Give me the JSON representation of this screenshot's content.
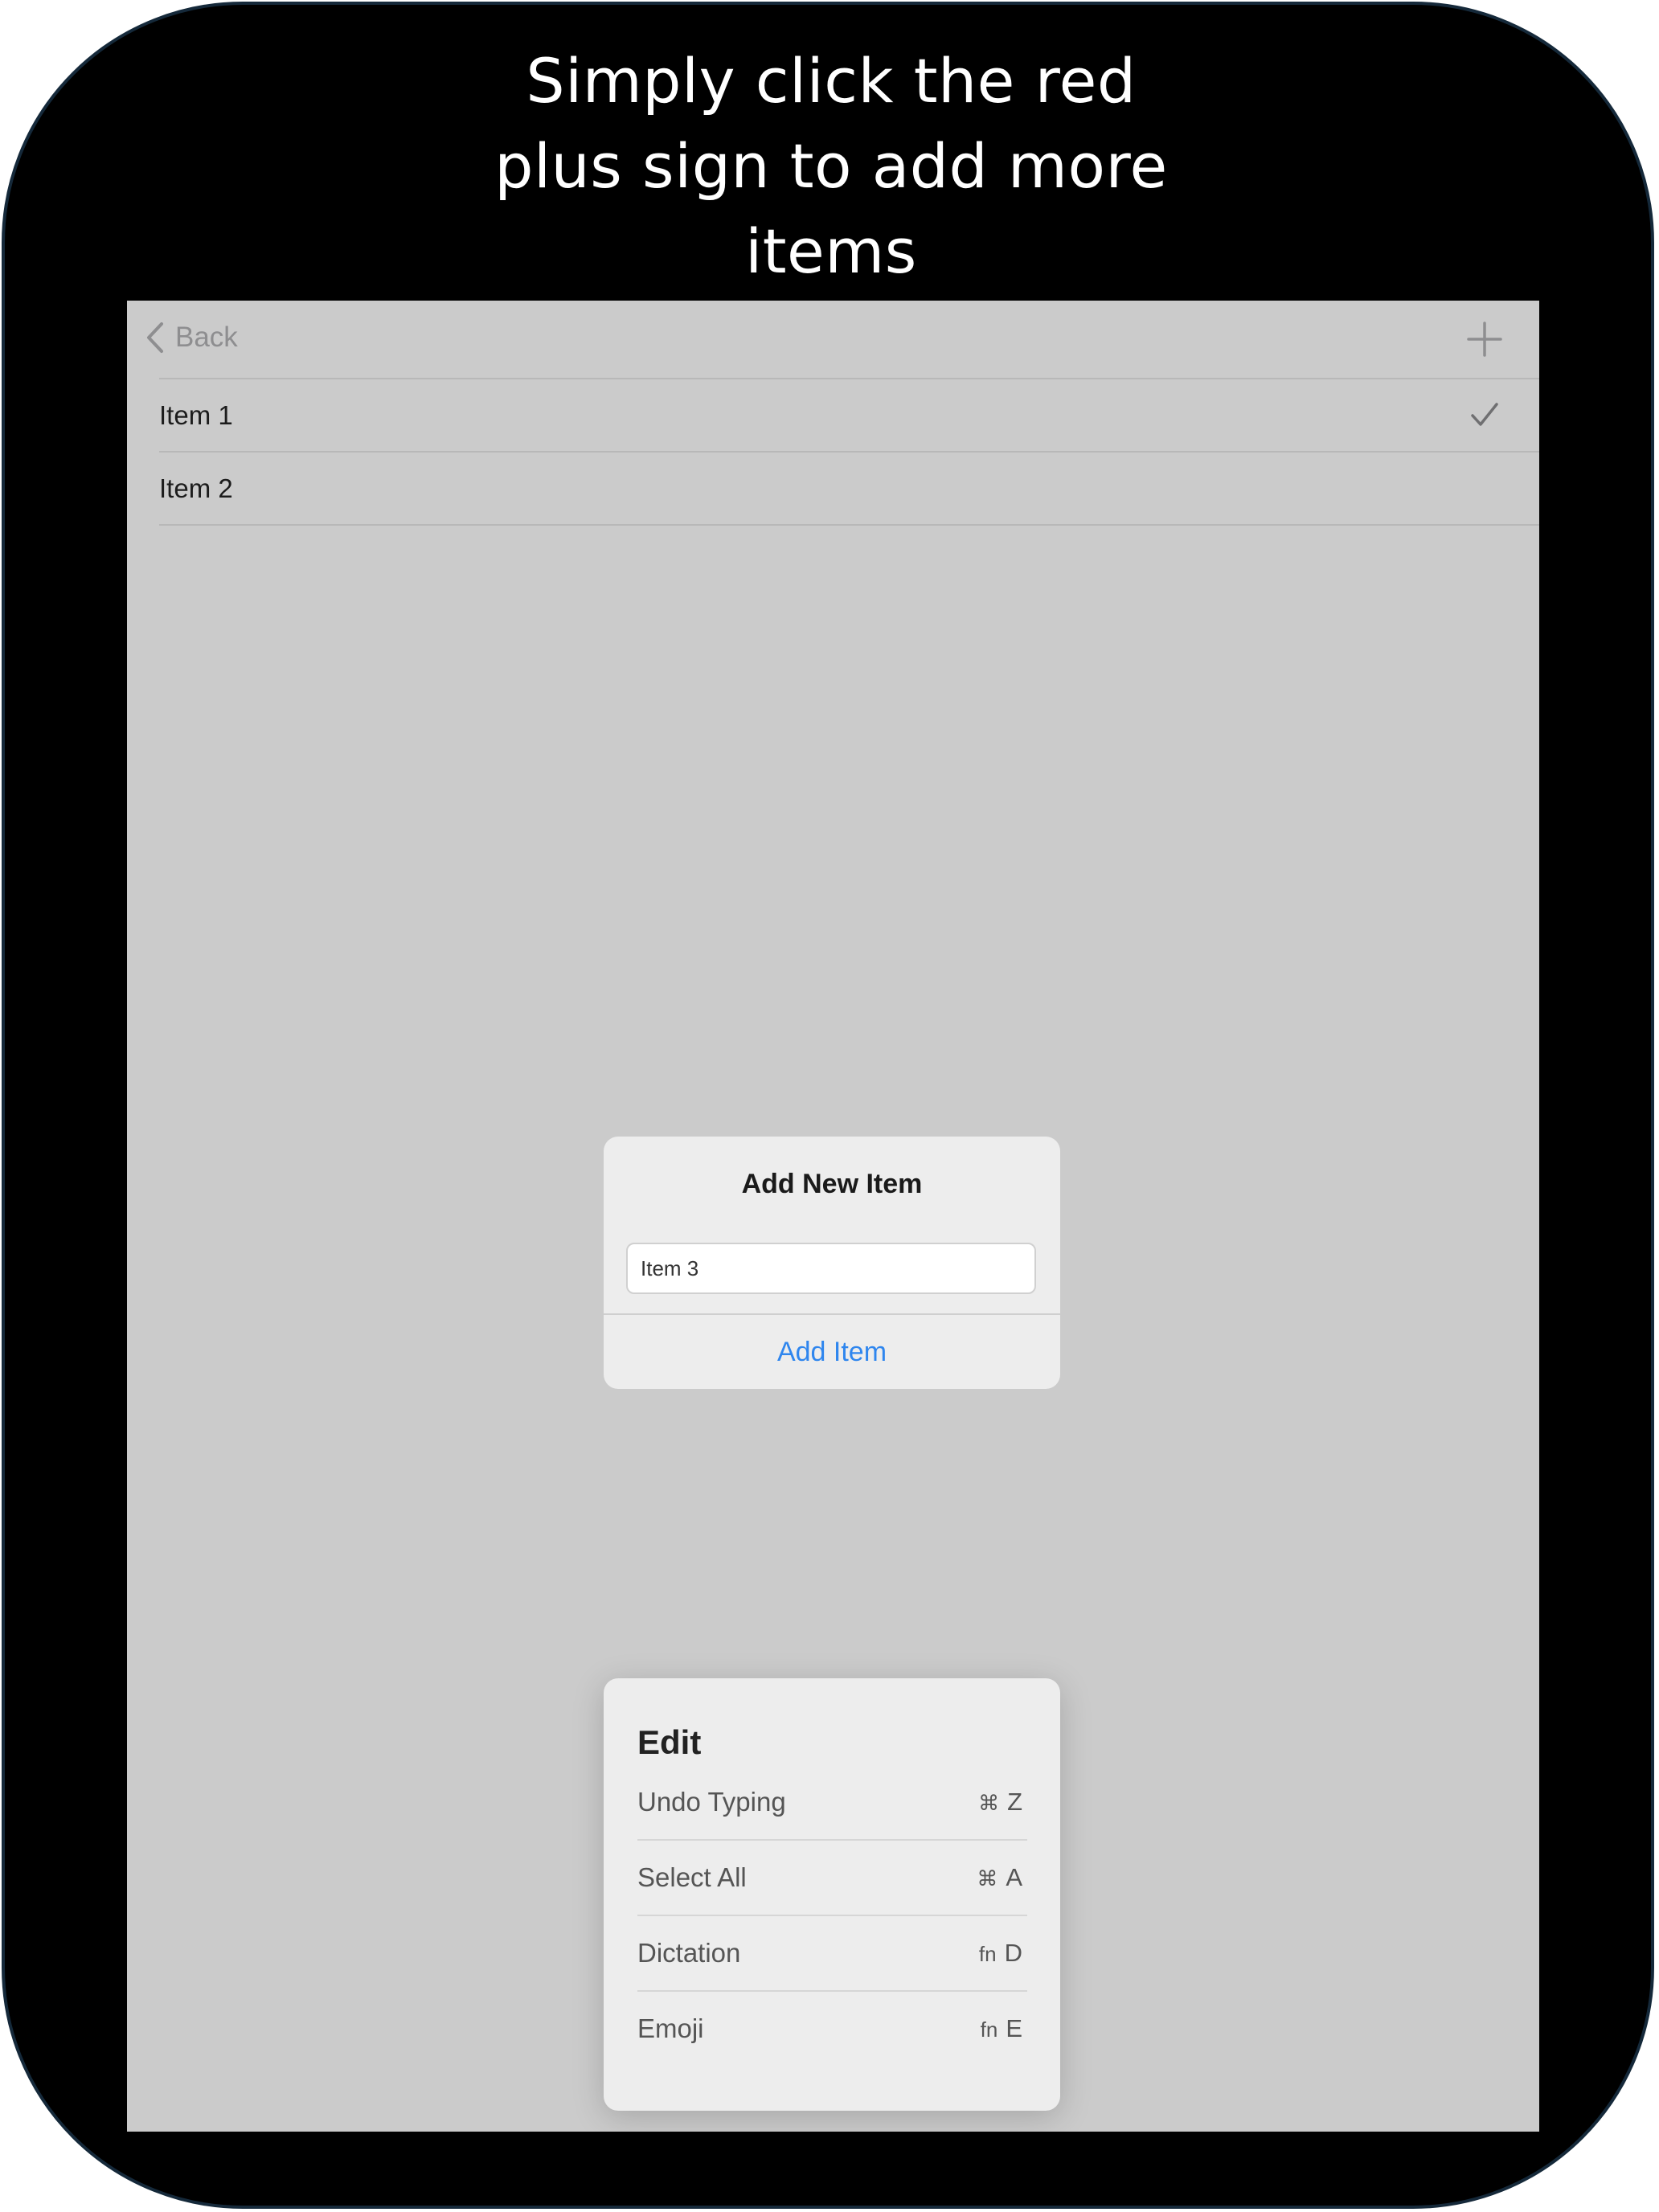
{
  "caption": {
    "lines": [
      "Simply click the red",
      "plus sign to add more",
      "items"
    ]
  },
  "navbar": {
    "back_label": "Back",
    "back_icon": "chevron-left-icon",
    "add_icon": "plus-icon"
  },
  "list": {
    "items": [
      {
        "label": "Item 1",
        "checked": true
      },
      {
        "label": "Item 2",
        "checked": false
      }
    ]
  },
  "alert": {
    "title": "Add New Item",
    "input_value": "Item 3",
    "action_label": "Add Item"
  },
  "edit_menu": {
    "title": "Edit",
    "items": [
      {
        "label": "Undo Typing",
        "modifier": "⌘",
        "key": "Z"
      },
      {
        "label": "Select All",
        "modifier": "⌘",
        "key": "A"
      },
      {
        "label": "Dictation",
        "modifier": "fn",
        "key": "D"
      },
      {
        "label": "Emoji",
        "modifier": "fn",
        "key": "E"
      }
    ]
  },
  "colors": {
    "screen_bg": "#cbcbcb",
    "accent_blue": "#2f86ee",
    "frame": "#000000"
  }
}
